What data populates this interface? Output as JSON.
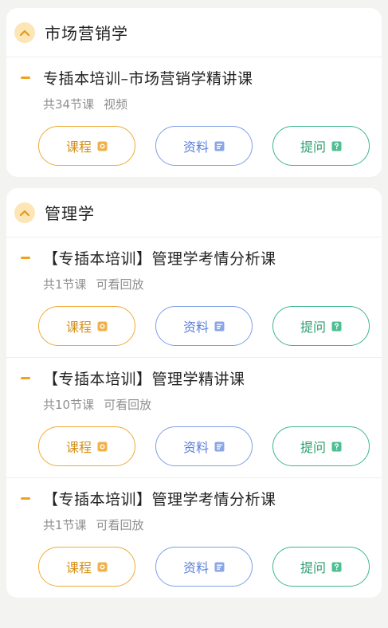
{
  "sections": [
    {
      "title": "市场营销学",
      "courses": [
        {
          "title": "专插本培训–市场营销学精讲课",
          "lesson_count": "共34节课",
          "type": "视频"
        }
      ]
    },
    {
      "title": "管理学",
      "courses": [
        {
          "title": "【专插本培训】管理学考情分析课",
          "lesson_count": "共1节课",
          "type": "可看回放"
        },
        {
          "title": "【专插本培训】管理学精讲课",
          "lesson_count": "共10节课",
          "type": "可看回放"
        },
        {
          "title": "【专插本培训】管理学考情分析课",
          "lesson_count": "共1节课",
          "type": "可看回放"
        }
      ]
    }
  ],
  "buttons": {
    "course_label": "课程",
    "materials_label": "资料",
    "ask_label": "提问"
  },
  "icons": {
    "collapse": "chevron-up-icon",
    "course": "play-circle-icon",
    "materials": "document-icon",
    "ask": "question-icon"
  },
  "colors": {
    "accent": "#f0a21c",
    "course_button": "#eeab35",
    "materials_button": "#7f9ee6",
    "ask_button": "#3db88a"
  }
}
